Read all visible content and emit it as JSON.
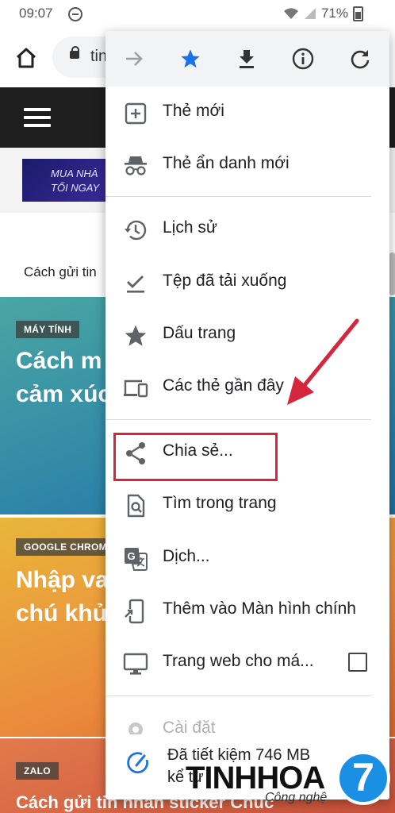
{
  "status_bar": {
    "time": "09:07",
    "battery": "71%"
  },
  "browser": {
    "url_partial": "tin"
  },
  "page": {
    "banner_ad": {
      "line1": "MUA NHÀ",
      "line2": "TỐI NGAY"
    },
    "breadcrumb": "Cách gửi tin",
    "cards": [
      {
        "tag": "MÁY TÍNH",
        "title_line1": "Cách m",
        "title_line2": "cảm xúc"
      },
      {
        "tag": "GOOGLE CHROM",
        "title_line1": "Nhập va",
        "title_line2": "chú khử"
      },
      {
        "tag": "ZALO",
        "title_line1": "Cách gửi tin nhắn sticker Chúc"
      }
    ]
  },
  "menu": {
    "top_icons": [
      "forward-icon",
      "star-filled-icon",
      "download-icon",
      "info-icon",
      "refresh-icon"
    ],
    "accent_color": "#1a73e8",
    "items": [
      {
        "label": "Thẻ mới",
        "icon": "new-tab-icon"
      },
      {
        "label": "Thẻ ẩn danh mới",
        "icon": "incognito-icon"
      },
      {
        "label": "Lịch sử",
        "icon": "history-icon"
      },
      {
        "label": "Tệp đã tải xuống",
        "icon": "downloads-check-icon"
      },
      {
        "label": "Dấu trang",
        "icon": "star-icon"
      },
      {
        "label": "Các thẻ gần đây",
        "icon": "devices-icon"
      },
      {
        "label": "Chia sẻ...",
        "icon": "share-icon"
      },
      {
        "label": "Tìm trong trang",
        "icon": "find-in-page-icon"
      },
      {
        "label": "Dịch...",
        "icon": "translate-icon"
      },
      {
        "label": "Thêm vào Màn hình chính",
        "icon": "add-to-home-icon"
      },
      {
        "label": "Trang web cho má...",
        "icon": "desktop-icon",
        "checked": false
      },
      {
        "label": "Cài đặt",
        "icon": "gear-icon"
      }
    ],
    "data_saver": {
      "line1": "Đã tiết kiệm 746 MB",
      "line2": "kể từ"
    }
  },
  "annotation": {
    "highlight_color": "#d6263c"
  },
  "watermark": {
    "brand": "TINHHOA",
    "sub": "Công nghệ",
    "logo": "7"
  }
}
